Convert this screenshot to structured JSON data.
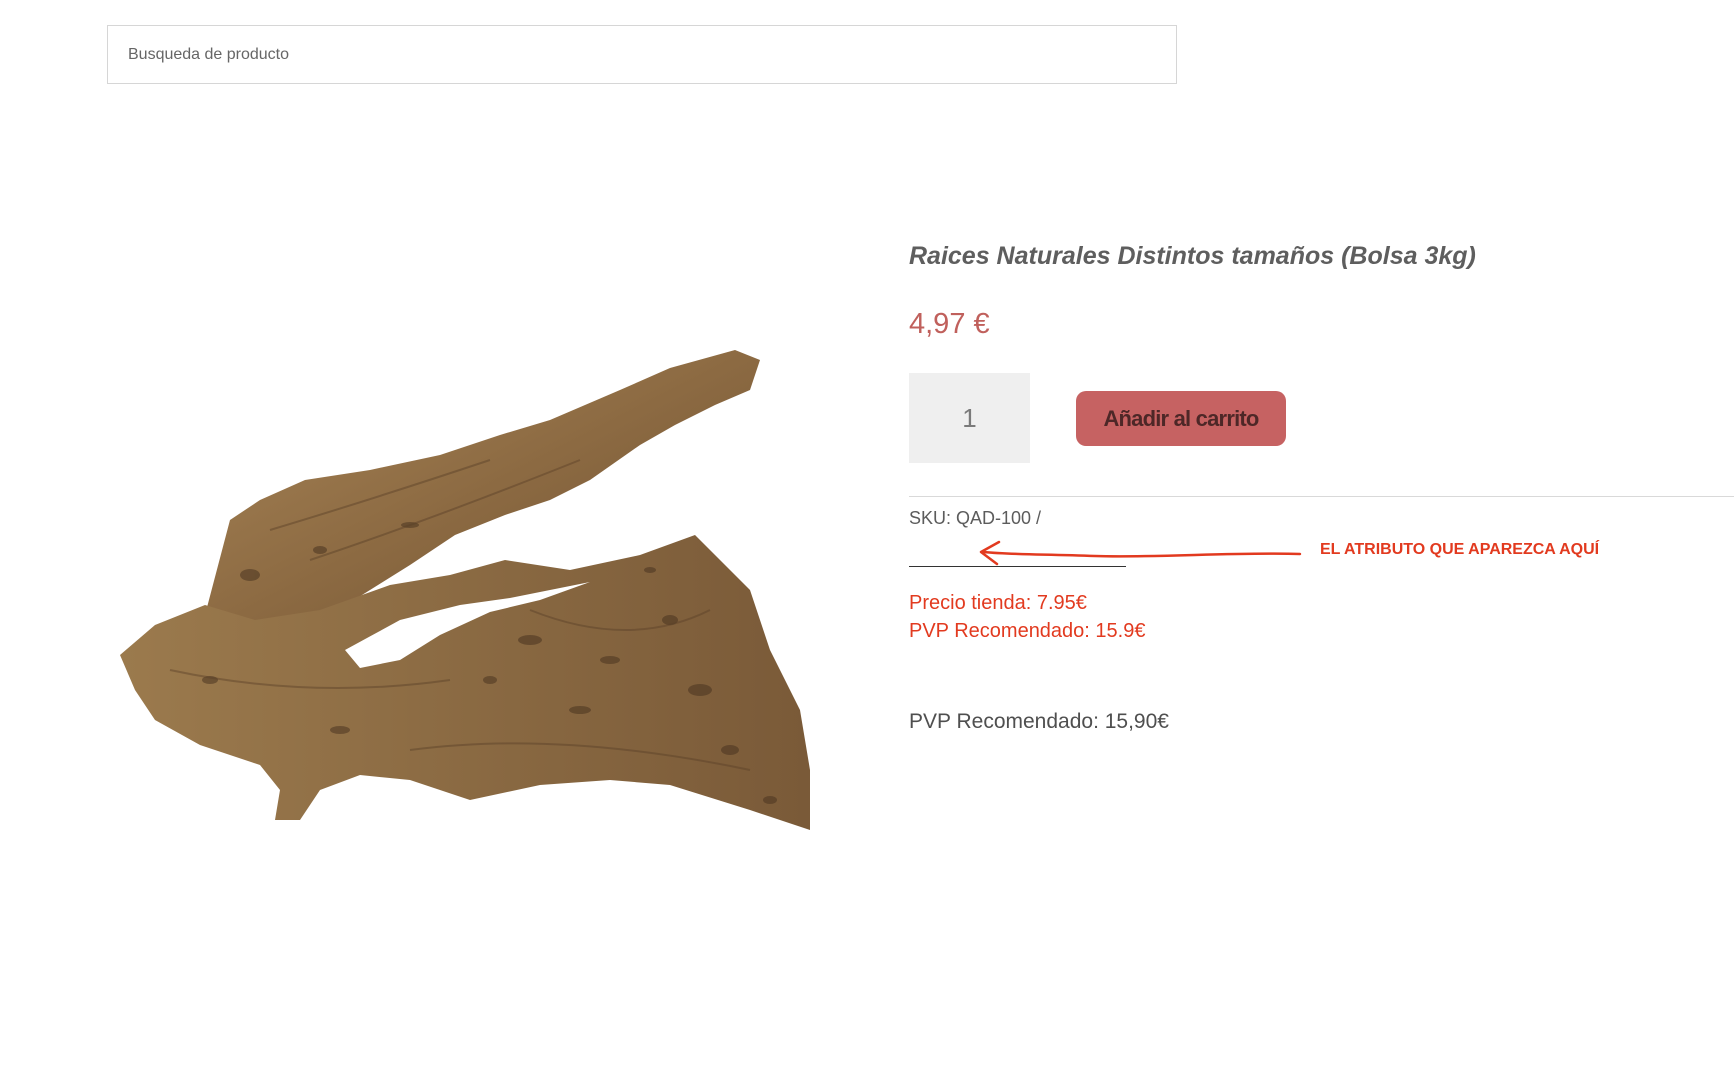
{
  "search": {
    "placeholder": "Busqueda de producto"
  },
  "product": {
    "title": "Raices Naturales Distintos tamaños (Bolsa 3kg)",
    "price": "4,97 €",
    "quantity": "1",
    "add_to_cart_label": "Añadir al carrito",
    "sku_line": "SKU: QAD-100 /",
    "store_price": "Precio tienda: 7.95€",
    "rrp_red": "PVP Recomendado: 15.9€",
    "rrp_final": "PVP Recomendado: 15,90€",
    "image_icon": "driftwood-root-image"
  },
  "annotation": {
    "text": "EL ATRIBUTO QUE APAREZCA AQUÍ",
    "color": "#e23a1f"
  },
  "colors": {
    "accent": "#c66262",
    "price": "#c0605c",
    "annotation": "#e23a1f"
  }
}
